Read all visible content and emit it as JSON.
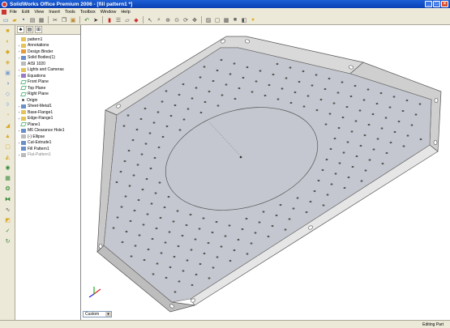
{
  "window": {
    "title": "SolidWorks Office Premium 2006 - [fill pattern1 *]"
  },
  "menu": [
    "File",
    "Edit",
    "View",
    "Insert",
    "Tools",
    "Toolbox",
    "Window",
    "Help"
  ],
  "tree": {
    "items": [
      {
        "label": "pattern1",
        "icon": "part-icon",
        "expand": ""
      },
      {
        "label": "Annotations",
        "icon": "annotations-icon",
        "expand": "+"
      },
      {
        "label": "Design Binder",
        "icon": "binder-icon",
        "expand": "+"
      },
      {
        "label": "Solid Bodies(1)",
        "icon": "solid-bodies-icon",
        "expand": "+"
      },
      {
        "label": "AISI 1020",
        "icon": "material-icon",
        "expand": ""
      },
      {
        "label": "Lights and Cameras",
        "icon": "lights-icon",
        "expand": "+"
      },
      {
        "label": "Equations",
        "icon": "equations-icon",
        "expand": "+"
      },
      {
        "label": "Front Plane",
        "icon": "plane-icon",
        "expand": ""
      },
      {
        "label": "Top Plane",
        "icon": "plane-icon",
        "expand": ""
      },
      {
        "label": "Right Plane",
        "icon": "plane-icon",
        "expand": ""
      },
      {
        "label": "Origin",
        "icon": "origin-icon",
        "expand": ""
      },
      {
        "label": "Sheet-Metal1",
        "icon": "sheet-metal-icon",
        "expand": "+"
      },
      {
        "label": "Base-Flange1",
        "icon": "flange-icon",
        "expand": "+"
      },
      {
        "label": "Edge-Flange1",
        "icon": "flange-icon",
        "expand": "+"
      },
      {
        "label": "Plane1",
        "icon": "plane-icon",
        "expand": ""
      },
      {
        "label": "M6 Clearance Hole1",
        "icon": "hole-icon",
        "expand": "+"
      },
      {
        "label": "(-) Ellipse",
        "icon": "sketch-icon",
        "expand": ""
      },
      {
        "label": "Cut-Extrude1",
        "icon": "cut-icon",
        "expand": "+"
      },
      {
        "label": "Fill Pattern1",
        "icon": "pattern-icon",
        "expand": ""
      },
      {
        "label": "Flat-Pattern1",
        "icon": "flat-pattern-icon",
        "expand": "+"
      }
    ]
  },
  "configuration": {
    "value": "Custom"
  },
  "status": {
    "text": "Editing Part"
  }
}
